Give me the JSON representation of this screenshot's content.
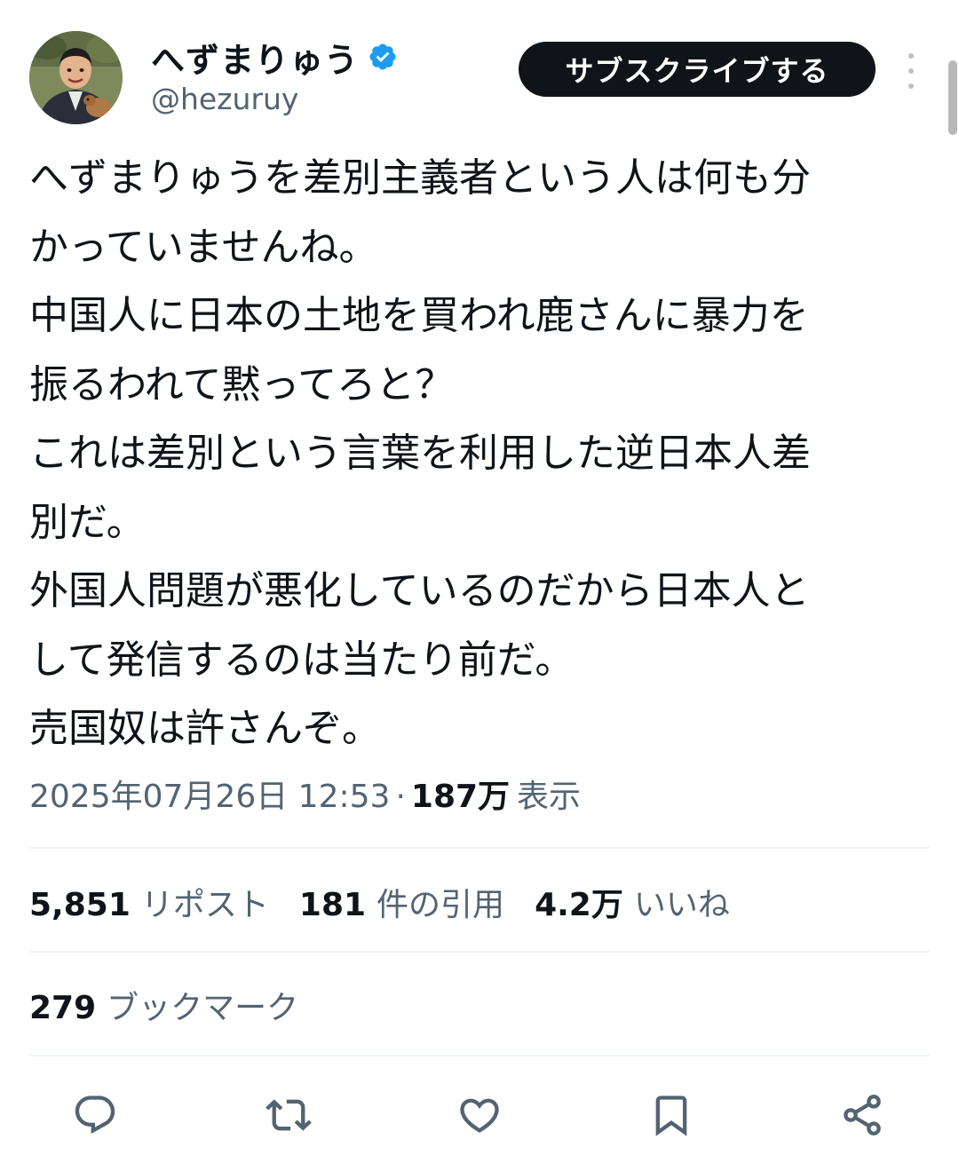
{
  "user": {
    "display_name": "へずまりゅう",
    "handle": "@hezuruy",
    "verified_icon": "verified-badge-icon",
    "avatar_icon": "user-avatar"
  },
  "header": {
    "subscribe_label": "サブスクライブする",
    "more_icon": "more-vertical-icon"
  },
  "tweet": {
    "lines": [
      "へずまりゅうを差別主義者という人は何も分",
      "かっていませんね。",
      "中国人に日本の土地を買われ鹿さんに暴力を",
      "振るわれて黙ってろと？",
      "これは差別という言葉を利用した逆日本人差",
      "別だ。",
      "外国人問題が悪化しているのだから日本人と",
      "して発信するのは当たり前だ。",
      "売国奴は許さんぞ。"
    ],
    "timestamp": "2025年07月26日 12:53",
    "separator": "·",
    "views_count": "187万",
    "views_label": "表示"
  },
  "stats": {
    "reposts_count": "5,851",
    "reposts_label": "リポスト",
    "quotes_count": "181",
    "quotes_label": "件の引用",
    "likes_count": "4.2万",
    "likes_label": "いいね",
    "bookmarks_count": "279",
    "bookmarks_label": "ブックマーク"
  },
  "actions": [
    {
      "icon": "reply-icon"
    },
    {
      "icon": "retweet-icon"
    },
    {
      "icon": "like-icon"
    },
    {
      "icon": "bookmark-icon"
    },
    {
      "icon": "share-icon"
    }
  ],
  "colors": {
    "text_primary": "#0f1419",
    "text_secondary": "#536471",
    "verified_blue": "#1d9bf0",
    "divider": "#eff3f4",
    "button_bg": "#0f1419"
  }
}
